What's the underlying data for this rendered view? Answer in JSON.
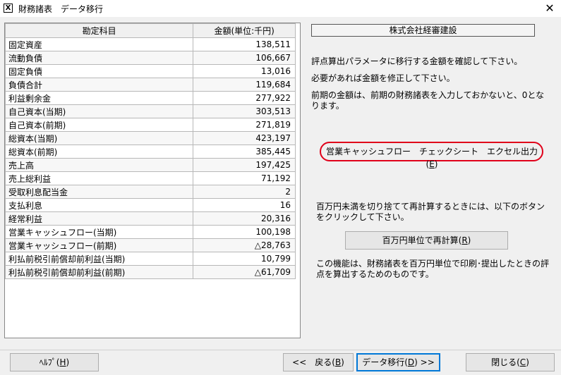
{
  "window": {
    "title": "財務諸表　データ移行",
    "icon_name": "app-icon",
    "icon_glyph": "X",
    "close_glyph": "✕"
  },
  "table": {
    "headers": [
      "勘定科目",
      "金額(単位:千円)"
    ],
    "rows": [
      {
        "name": "固定資産",
        "amount": "138,511"
      },
      {
        "name": "流動負債",
        "amount": "106,667"
      },
      {
        "name": "固定負債",
        "amount": "13,016"
      },
      {
        "name": "負債合計",
        "amount": "119,684"
      },
      {
        "name": "利益剰余金",
        "amount": "277,922"
      },
      {
        "name": "自己資本(当期)",
        "amount": "303,513"
      },
      {
        "name": "自己資本(前期)",
        "amount": "271,819"
      },
      {
        "name": "総資本(当期)",
        "amount": "423,197"
      },
      {
        "name": "総資本(前期)",
        "amount": "385,445"
      },
      {
        "name": "売上高",
        "amount": "197,425"
      },
      {
        "name": "売上総利益",
        "amount": "71,192"
      },
      {
        "name": "受取利息配当金",
        "amount": "2"
      },
      {
        "name": "支払利息",
        "amount": "16"
      },
      {
        "name": "経常利益",
        "amount": "20,316"
      },
      {
        "name": "営業キャッシュフロー(当期)",
        "amount": "100,198"
      },
      {
        "name": "営業キャッシュフロー(前期)",
        "amount": "△28,763"
      },
      {
        "name": "利払前税引前償却前利益(当期)",
        "amount": "10,799"
      },
      {
        "name": "利払前税引前償却前利益(前期)",
        "amount": "△61,709"
      }
    ]
  },
  "right": {
    "company": "株式会社経審建設",
    "instructions": [
      "評点算出パラメータに移行する金額を確認して下さい。",
      "必要があれば金額を修正して下さい。",
      "前期の金額は、前期の財務諸表を入力しておかないと、0となります。"
    ],
    "excel_button": {
      "label": "営業キャッシュフロー　チェックシート　エクセル出力(",
      "key": "E",
      "suffix": ")"
    },
    "highlight_color": "#e0001a",
    "recalc_text": "百万円未満を切り捨てて再計算するときには、以下のボタンをクリックして下さい。",
    "recalc_button": {
      "label": "百万円単位で再計算(",
      "key": "R",
      "suffix": ")"
    },
    "note_text": "この機能は、財務諸表を百万円単位で印刷･提出したときの評点を算出するためのものです。"
  },
  "footer": {
    "help": {
      "label": "ﾍﾙﾌﾟ(",
      "key": "H",
      "suffix": ")"
    },
    "back": {
      "label": "<<　戻る(",
      "key": "B",
      "suffix": ")"
    },
    "migrate": {
      "label": "データ移行(",
      "key": "D",
      "suffix": ") >>"
    },
    "close": {
      "label": "閉じる(",
      "key": "C",
      "suffix": ")"
    }
  }
}
